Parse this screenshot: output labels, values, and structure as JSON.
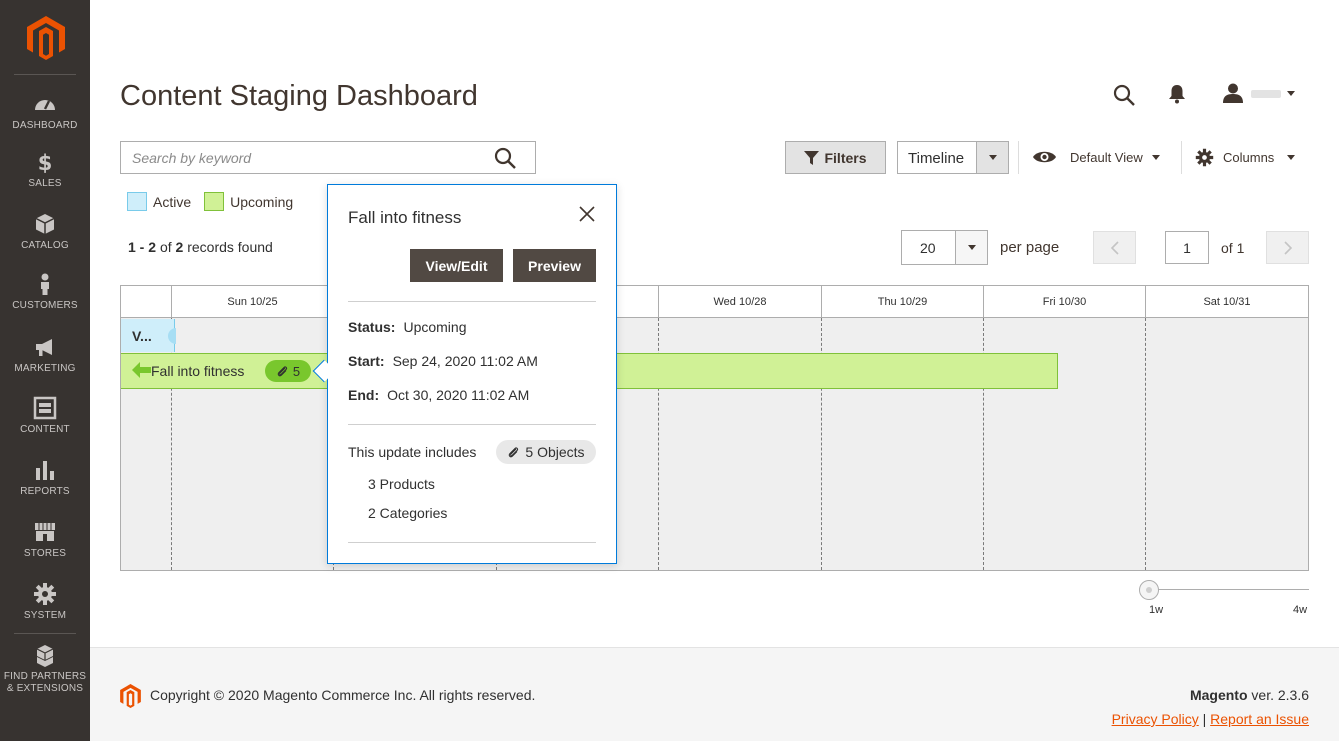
{
  "sidebar": {
    "items": [
      {
        "label": "DASHBOARD",
        "icon": "dashboard-icon"
      },
      {
        "label": "SALES",
        "icon": "dollar-icon"
      },
      {
        "label": "CATALOG",
        "icon": "box-icon"
      },
      {
        "label": "CUSTOMERS",
        "icon": "person-icon"
      },
      {
        "label": "MARKETING",
        "icon": "megaphone-icon"
      },
      {
        "label": "CONTENT",
        "icon": "content-icon"
      },
      {
        "label": "REPORTS",
        "icon": "bar-chart-icon"
      },
      {
        "label": "STORES",
        "icon": "store-icon"
      },
      {
        "label": "SYSTEM",
        "icon": "gear-icon"
      }
    ],
    "partners_line1": "FIND PARTNERS",
    "partners_line2": "& EXTENSIONS"
  },
  "header": {
    "title": "Content Staging Dashboard"
  },
  "search": {
    "placeholder": "Search by keyword",
    "value": ""
  },
  "toolbar": {
    "filters_label": "Filters",
    "view_mode": "Timeline",
    "default_view_label": "Default View",
    "columns_label": "Columns"
  },
  "legend": {
    "active_label": "Active",
    "upcoming_label": "Upcoming"
  },
  "records": {
    "from": "1",
    "to": "2",
    "of_label": "of",
    "total": "2",
    "suffix": "records found"
  },
  "pagination": {
    "per_page_value": "20",
    "per_page_label": "per page",
    "current_page": "1",
    "of_pages": "of 1"
  },
  "timeline": {
    "days": [
      "Sun 10/25",
      "Wed 10/28",
      "Thu 10/29",
      "Fri 10/30",
      "Sat 10/31"
    ],
    "active_update_label": "V...",
    "upcoming_update_name": "Fall into fitness",
    "upcoming_objects_count": "5"
  },
  "popup": {
    "title": "Fall into fitness",
    "view_edit_label": "View/Edit",
    "preview_label": "Preview",
    "status_label": "Status:",
    "status_value": "Upcoming",
    "start_label": "Start:",
    "start_value": "Sep 24, 2020 11:02 AM",
    "end_label": "End:",
    "end_value": "Oct 30, 2020 11:02 AM",
    "includes_label": "This update includes",
    "objects_label": "5 Objects",
    "products": "3 Products",
    "categories": "2 Categories"
  },
  "zoom": {
    "min_label": "1w",
    "max_label": "4w"
  },
  "footer": {
    "copyright": "Copyright © 2020 Magento Commerce Inc. All rights reserved.",
    "brand": "Magento",
    "version": "ver. 2.3.6",
    "privacy_label": "Privacy Policy",
    "separator": "|",
    "report_label": "Report an Issue"
  },
  "colors": {
    "sidebar_bg": "#373330",
    "brand_orange": "#eb5202",
    "active_fill": "#cfeefa",
    "upcoming_fill": "#d0f196",
    "popup_border": "#007bdb",
    "dark_button": "#514943"
  }
}
